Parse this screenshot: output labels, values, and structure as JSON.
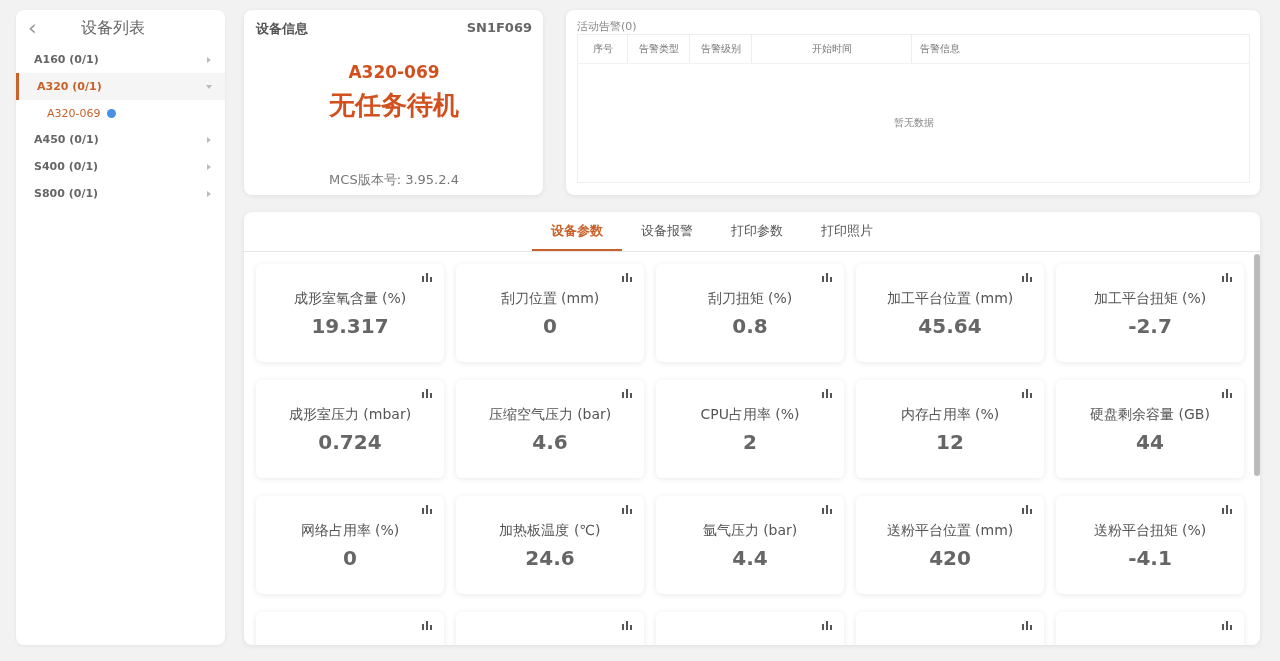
{
  "sidebar": {
    "title": "设备列表",
    "back_icon": "‹",
    "items": [
      {
        "label": "A160 (0/1)",
        "selected": false,
        "expanded": false
      },
      {
        "label": "A320 (0/1)",
        "selected": true,
        "expanded": true,
        "children": [
          {
            "label": "A320-069",
            "color": "#4a90e2"
          }
        ]
      },
      {
        "label": "A450 (0/1)",
        "selected": false,
        "expanded": false
      },
      {
        "label": "S400 (0/1)",
        "selected": false,
        "expanded": false
      },
      {
        "label": "S800 (0/1)",
        "selected": false,
        "expanded": false
      }
    ]
  },
  "device_info": {
    "title": "设备信息",
    "serial": "SN1F069",
    "name": "A320-069",
    "status": "无任务待机",
    "version": "MCS版本号: 3.95.2.4"
  },
  "alarms": {
    "title": "活动告警(0)",
    "columns": [
      "序号",
      "告警类型",
      "告警级别",
      "开始时间",
      "告警信息"
    ],
    "empty_text": "暂无数据"
  },
  "tabs": [
    {
      "label": "设备参数",
      "selected": true
    },
    {
      "label": "设备报警",
      "selected": false
    },
    {
      "label": "打印参数",
      "selected": false
    },
    {
      "label": "打印照片",
      "selected": false
    }
  ],
  "params": [
    {
      "kind": "card",
      "label": "成形室氧含量 (%)",
      "value": "19.317"
    },
    {
      "kind": "card",
      "label": "刮刀位置 (mm)",
      "value": "0"
    },
    {
      "kind": "card",
      "label": "刮刀扭矩 (%)",
      "value": "0.8"
    },
    {
      "kind": "card",
      "label": "加工平台位置 (mm)",
      "value": "45.64"
    },
    {
      "kind": "card",
      "label": "加工平台扭矩 (%)",
      "value": "-2.7"
    },
    {
      "kind": "card",
      "label": "成形室压力 (mbar)",
      "value": "0.724"
    },
    {
      "kind": "card",
      "label": "压缩空气压力 (bar)",
      "value": "4.6"
    },
    {
      "kind": "card",
      "label": "CPU占用率 (%)",
      "value": "2"
    },
    {
      "kind": "card",
      "label": "内存占用率 (%)",
      "value": "12"
    },
    {
      "kind": "card",
      "label": "硬盘剩余容量 (GB)",
      "value": "44"
    },
    {
      "kind": "card",
      "label": "网络占用率 (%)",
      "value": "0"
    },
    {
      "kind": "card",
      "label": "加热板温度 (℃)",
      "value": "24.6"
    },
    {
      "kind": "card",
      "label": "氩气压力 (bar)",
      "value": "4.4"
    },
    {
      "kind": "card",
      "label": "送粉平台位置 (mm)",
      "value": "420"
    },
    {
      "kind": "card",
      "label": "送粉平台扭矩 (%)",
      "value": "-4.1"
    },
    {
      "kind": "cut"
    },
    {
      "kind": "cut"
    },
    {
      "kind": "cut"
    },
    {
      "kind": "cut"
    },
    {
      "kind": "cut"
    }
  ]
}
